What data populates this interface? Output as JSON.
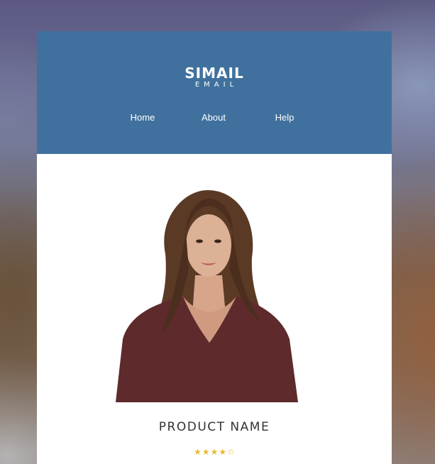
{
  "brand": {
    "name": "SIMAIL",
    "tagline": "EMAIL"
  },
  "nav": {
    "items": [
      {
        "label": "Home"
      },
      {
        "label": "About"
      },
      {
        "label": "Help"
      }
    ]
  },
  "product": {
    "name": "PRODUCT NAME",
    "rating": 4,
    "rating_max": 5,
    "image_icon": "woman-portrait"
  },
  "colors": {
    "header": "#40719e",
    "star": "#e8b92c",
    "text": "#333333"
  }
}
